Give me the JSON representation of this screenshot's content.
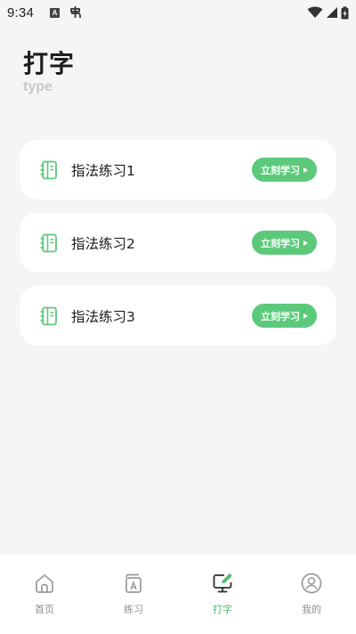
{
  "status_bar": {
    "time": "9:34",
    "left_icons": [
      "a-notification-icon",
      "app-notification-icon"
    ],
    "right_icons": [
      "wifi-icon",
      "cellular-signal-icon",
      "battery-charging-icon"
    ]
  },
  "header": {
    "title": "打字",
    "subtitle": "type"
  },
  "cards": [
    {
      "label": "指法练习1",
      "button_label": "立刻学习",
      "icon": "notebook-icon"
    },
    {
      "label": "指法练习2",
      "button_label": "立刻学习",
      "icon": "notebook-icon"
    },
    {
      "label": "指法练习3",
      "button_label": "立刻学习",
      "icon": "notebook-icon"
    }
  ],
  "bottom_nav": {
    "items": [
      {
        "label": "首页",
        "icon": "home-icon",
        "active": false
      },
      {
        "label": "练习",
        "icon": "practice-book-icon",
        "active": false
      },
      {
        "label": "打字",
        "icon": "monitor-edit-icon",
        "active": true
      },
      {
        "label": "我的",
        "icon": "profile-icon",
        "active": false
      }
    ]
  },
  "colors": {
    "accent": "#5cc97a",
    "active_tab": "#4cbb67",
    "background": "#f4f5f4",
    "card": "#ffffff",
    "subtitle": "#c8c8c8",
    "inactive_tab": "#8f8f8f"
  }
}
